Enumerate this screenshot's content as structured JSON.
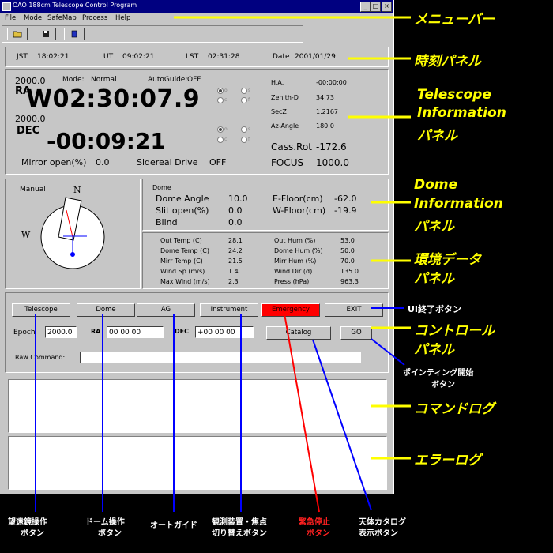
{
  "window": {
    "title": "OAO 188cm Telescope Control Program",
    "controls": [
      "_",
      "□",
      "×"
    ]
  },
  "menu": [
    "File",
    "Mode",
    "SafeMap",
    "Process",
    "Help"
  ],
  "toolbar": {
    "icons": [
      "open-folder-icon",
      "save-disk-icon",
      "book-icon"
    ]
  },
  "time_panel": {
    "jst_label": "JST",
    "jst": "18:02:21",
    "ut_label": "UT",
    "ut": "09:02:21",
    "lst_label": "LST",
    "lst": "02:31:28",
    "date_label": "Date",
    "date": "2001/01/29"
  },
  "telescope": {
    "ra_epoch": "2000.0",
    "ra_label": "RA",
    "ra_value": "W02:30:07.9",
    "dec_epoch": "2000.0",
    "dec_label": "DEC",
    "dec_value": "-00:09:21",
    "mode_label": "Mode:",
    "mode_value": "Normal",
    "autoguide_label": "AutoGuide:",
    "autoguide_value": "OFF",
    "ra_radios": [
      "o",
      "s",
      "c",
      "f"
    ],
    "dec_radios": [
      "o",
      "s",
      "c",
      "f"
    ],
    "ha_label": "H.A.",
    "ha_value": "-00:00:00",
    "zenith_label": "Zenith-D",
    "zenith_value": "34.73",
    "secz_label": "SecZ",
    "secz_value": "1.2167",
    "az_label": "Az-Angle",
    "az_value": "180.0",
    "cassrot_label": "Cass.Rot",
    "cassrot_value": "-172.6",
    "focus_label": "FOCUS",
    "focus_value": "1000.0",
    "mirror_label": "Mirror open(%)",
    "mirror_value": "0.0",
    "sidereal_label": "Sidereal Drive",
    "sidereal_value": "OFF"
  },
  "compass": {
    "mode": "Manual",
    "north": "N",
    "west": "W"
  },
  "dome": {
    "title": "Dome",
    "angle_label": "Dome Angle",
    "angle_value": "10.0",
    "slit_label": "Slit open(%)",
    "slit_value": "0.0",
    "blind_label": "Blind",
    "blind_value": "0.0",
    "efloor_label": "E-Floor(cm)",
    "efloor_value": "-62.0",
    "wfloor_label": "W-Floor(cm)",
    "wfloor_value": "-19.9"
  },
  "env": {
    "rows_left": [
      {
        "label": "Out Temp (C)",
        "value": "28.1"
      },
      {
        "label": "Dome Temp (C)",
        "value": "24.2"
      },
      {
        "label": "Mirr Temp (C)",
        "value": "21.5"
      },
      {
        "label": "Wind Sp (m/s)",
        "value": "1.4"
      },
      {
        "label": "Max Wind (m/s)",
        "value": "2.3"
      }
    ],
    "rows_right": [
      {
        "label": "Out Hum (%)",
        "value": "53.0"
      },
      {
        "label": "Dome Hum (%)",
        "value": "50.0"
      },
      {
        "label": "Mirr Hum (%)",
        "value": "70.0"
      },
      {
        "label": "Wind Dir (d)",
        "value": "135.0"
      },
      {
        "label": "Press (hPa)",
        "value": "963.3"
      }
    ]
  },
  "controls": {
    "telescope": "Telescope",
    "dome": "Dome",
    "ag": "AG",
    "instrument": "Instrument",
    "emergency": "Emergency",
    "exit": "EXIT",
    "epoch_label": "Epoch",
    "epoch_value": "2000.0",
    "ra_label": "RA",
    "ra_value": "00 00 00",
    "dec_label": "DEC",
    "dec_value": "+00 00 00",
    "catalog": "Catalog",
    "go": "GO",
    "raw_label": "Raw Command:",
    "raw_value": ""
  },
  "annotations": {
    "menubar": "メニューバー",
    "time_panel": "時刻パネル",
    "telescope1": "Telescope",
    "telescope2": "Information",
    "telescope3": "パネル",
    "dome1": "Dome",
    "dome2": "Information",
    "dome3": "パネル",
    "env1": "環境データ",
    "env2": "パネル",
    "ui_exit": "UI終了ボタン",
    "control1": "コントロール",
    "control2": "パネル",
    "pointing1": "ポインティング開始",
    "pointing2": "ボタン",
    "command_log": "コマンドログ",
    "error_log": "エラーログ",
    "telescope_btn1": "望遠鏡操作",
    "telescope_btn2": "ボタン",
    "dome_btn1": "ドーム操作",
    "dome_btn2": "ボタン",
    "autoguide": "オートガイド",
    "instrument1": "観測装置・焦点",
    "instrument2": "切り替えボタン",
    "emergency1": "緊急停止",
    "emergency2": "ボタン",
    "catalog1": "天体カタログ",
    "catalog2": "表示ボタン"
  },
  "colors": {
    "emergency": "#ff0000",
    "annotation": "#ffff00",
    "arrow_blue": "#0000ff",
    "arrow_red": "#ff0000"
  }
}
